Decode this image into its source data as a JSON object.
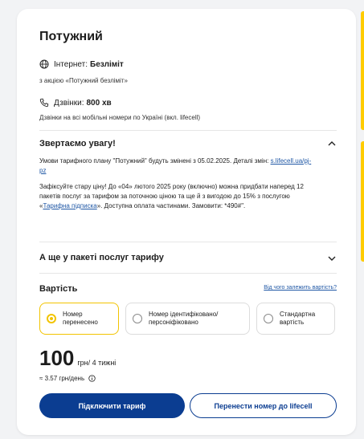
{
  "tariff": {
    "title": "Потужний",
    "internet": {
      "label": "Інтернет:",
      "value": "Безліміт",
      "note": "з акцією «Потужний безліміт»",
      "icon": "globe-icon"
    },
    "calls": {
      "label": "Дзвінки:",
      "value": "800 хв",
      "note": "Дзвінки на всі мобільні номери по Україні (вкл. lifecell)",
      "icon": "phone-icon"
    }
  },
  "notice": {
    "title": "Звертаємо увагу!",
    "paragraph1_prefix": "Умови тарифного плану \"Потужний\" будуть змінені з 05.02.2025. Деталі змін: ",
    "paragraph1_link": "s.lifecell.ua/pj-pz",
    "paragraph2_prefix": "Зафіксуйте стару ціну! До «04» лютого 2025 року (включно) можна придбати наперед 12 пакетів послуг за тарифом за поточною ціною та ще й з вигодою до 15% з послугою «",
    "paragraph2_link": "Тарифна підписка",
    "paragraph2_suffix": "». Доступна оплата частинами. Замовити: *490#\"."
  },
  "package": {
    "title": "А ще у пакеті послуг тарифу"
  },
  "pricing": {
    "label": "Вартість",
    "help_link": "Від чого залежить вартість?",
    "options": [
      {
        "label": "Номер перенесено",
        "selected": true
      },
      {
        "label": "Номер ідентифіковано/ персоніфіковано",
        "selected": false
      },
      {
        "label": "Стандартна вартість",
        "selected": false
      }
    ],
    "amount": "100",
    "unit": "грн/ 4 тижні",
    "per_day": "≈ 3.57 грн/день"
  },
  "buttons": {
    "connect": "Підключити тариф",
    "transfer": "Перенести номер до lifecell"
  },
  "colors": {
    "accent_yellow": "#ffcc00",
    "brand_blue": "#0b3d91",
    "link_blue": "#1f57a5"
  }
}
